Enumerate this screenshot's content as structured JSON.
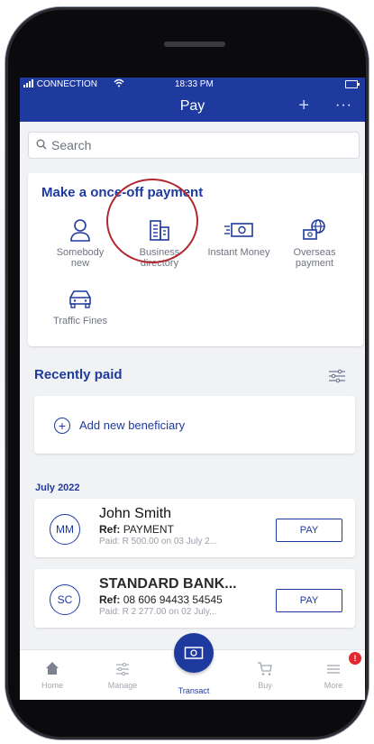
{
  "status_bar": {
    "carrier": "CONNECTION",
    "time": "18:33 PM"
  },
  "header": {
    "title": "Pay",
    "add_label": "+",
    "more_label": "···"
  },
  "search": {
    "placeholder": "Search"
  },
  "once_off": {
    "heading": "Make a once-off payment",
    "options": [
      {
        "line1": "Somebody",
        "line2": "new",
        "icon": "person-icon"
      },
      {
        "line1": "Business",
        "line2": "directory",
        "icon": "building-icon"
      },
      {
        "line1": "Instant Money",
        "line2": "",
        "icon": "cash-icon"
      },
      {
        "line1": "Overseas",
        "line2": "payment",
        "icon": "globe-cash-icon"
      },
      {
        "line1": "Traffic Fines",
        "line2": "",
        "icon": "car-icon"
      }
    ]
  },
  "recently_paid": {
    "title": "Recently paid",
    "add_beneficiary": "Add new beneficiary",
    "month": "July 2022",
    "items": [
      {
        "initials": "MM",
        "name": "John Smith",
        "ref_label": "Ref:",
        "ref_value": "PAYMENT",
        "paid": "Paid: R 500.00 on 03 July 2...",
        "button": "PAY"
      },
      {
        "initials": "SC",
        "name": "STANDARD BANK...",
        "ref_label": "Ref:",
        "ref_value": "08 606 94433 54545",
        "paid": "Paid: R 2 277.00 on 02 July...",
        "button": "PAY"
      }
    ]
  },
  "bottom_nav": {
    "items": [
      {
        "label": "Home",
        "icon": "home-icon"
      },
      {
        "label": "Manage",
        "icon": "sliders-icon"
      },
      {
        "label": "Transact",
        "icon": "cash-icon"
      },
      {
        "label": "Buy",
        "icon": "cart-icon"
      },
      {
        "label": "More",
        "icon": "menu-icon"
      }
    ],
    "more_badge": "!"
  },
  "colors": {
    "brand": "#1f3a9e",
    "highlight_ring": "#b1282f",
    "badge": "#e3282f"
  }
}
